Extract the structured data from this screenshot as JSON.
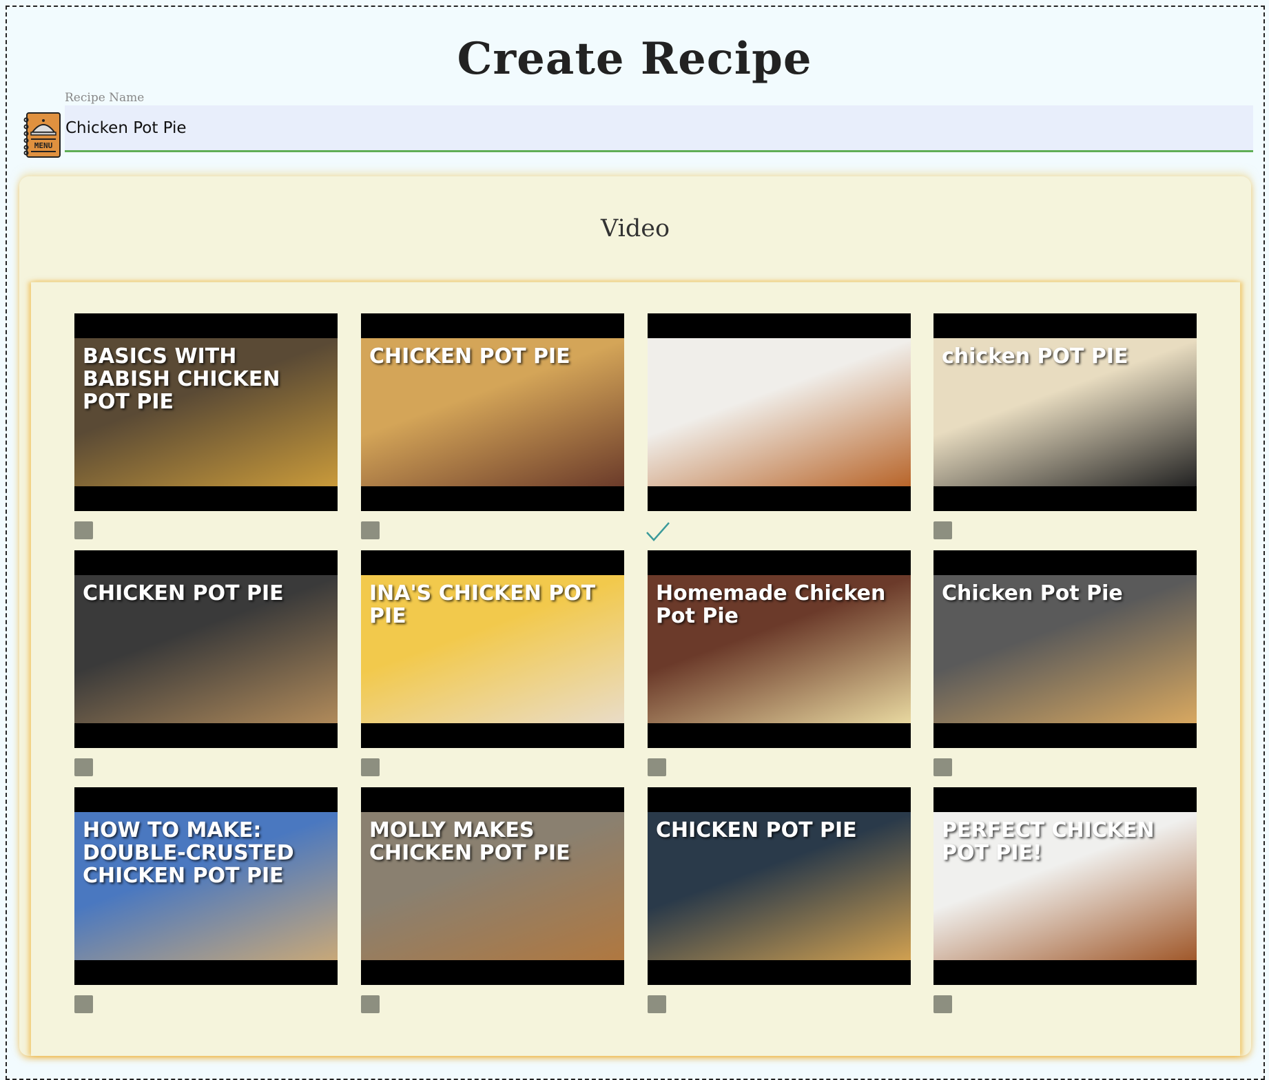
{
  "header": {
    "title": "Create Recipe"
  },
  "recipe_name": {
    "label": "Recipe Name",
    "value": "Chicken Pot Pie",
    "icon": "menu-book-icon",
    "icon_text": "MENU"
  },
  "video": {
    "title": "Video",
    "items": [
      {
        "overlay": "BASICS WITH BABISH CHICKEN POT PIE",
        "bg": "#5a4a35",
        "bg2": "#c99a3a",
        "selected": false
      },
      {
        "overlay": "CHICKEN POT PIE",
        "bg": "#d4a558",
        "bg2": "#6b3b2a",
        "selected": false
      },
      {
        "overlay": "",
        "bg": "#f0eeea",
        "bg2": "#b8652a",
        "selected": true
      },
      {
        "overlay": "chicken POT PIE",
        "bg": "#e8dcc0",
        "bg2": "#222",
        "selected": false
      },
      {
        "overlay": "CHICKEN POT PIE",
        "bg": "#3a3a3a",
        "bg2": "#b08a5a",
        "selected": false
      },
      {
        "overlay": "INA'S CHICKEN POT PIE",
        "bg": "#f2c94c",
        "bg2": "#e9dcc7",
        "selected": false
      },
      {
        "overlay": "Homemade Chicken Pot Pie",
        "bg": "#6b3a2a",
        "bg2": "#e8d8a0",
        "selected": false
      },
      {
        "overlay": "Chicken Pot Pie",
        "bg": "#5a5a5a",
        "bg2": "#d8a860",
        "selected": false
      },
      {
        "overlay": "HOW TO MAKE: DOUBLE-CRUSTED CHICKEN POT PIE",
        "bg": "#4a78c0",
        "bg2": "#c8a878",
        "selected": false
      },
      {
        "overlay": "MOLLY MAKES CHICKEN POT PIE",
        "bg": "#8a8070",
        "bg2": "#b07840",
        "selected": false
      },
      {
        "overlay": "CHICKEN POT PIE",
        "bg": "#2a3a4a",
        "bg2": "#d0a050",
        "selected": false
      },
      {
        "overlay": "PERFECT CHICKEN POT PIE!",
        "bg": "#f0f0ee",
        "bg2": "#a0582a",
        "selected": false
      }
    ]
  },
  "colors": {
    "checkbox": "#8d8f80",
    "check": "#3a9a9a",
    "underline": "#5fae55"
  }
}
